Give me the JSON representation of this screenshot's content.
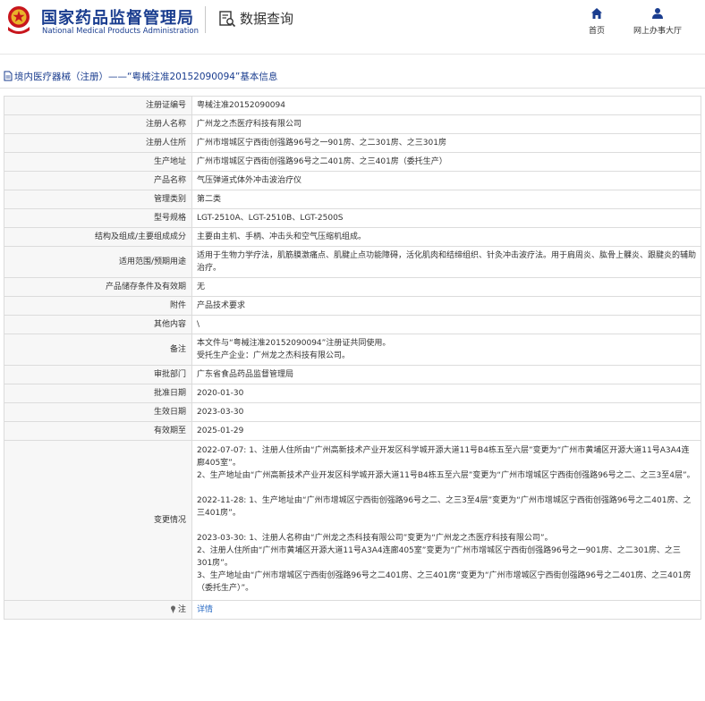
{
  "header": {
    "brand_cn": "国家药品监督管理局",
    "brand_en": "National Medical Products Administration",
    "query_label": "数据查询",
    "nav": [
      {
        "label": "首页",
        "icon": "home-icon"
      },
      {
        "label": "网上办事大厅",
        "icon": "user-icon"
      }
    ],
    "brand_color": "#1a3d8f",
    "logo_color": "#c8161d"
  },
  "breadcrumb": "境内医疗器械（注册）——“粤械注准20152090094”基本信息",
  "fields": [
    {
      "label": "注册证编号",
      "value": "粤械注准20152090094"
    },
    {
      "label": "注册人名称",
      "value": "广州龙之杰医疗科技有限公司"
    },
    {
      "label": "注册人住所",
      "value": "广州市增城区宁西街创强路96号之一901房、之二301房、之三301房"
    },
    {
      "label": "生产地址",
      "value": "广州市增城区宁西街创强路96号之二401房、之三401房（委托生产）"
    },
    {
      "label": "产品名称",
      "value": "气压弹道式体外冲击波治疗仪"
    },
    {
      "label": "管理类别",
      "value": "第二类"
    },
    {
      "label": "型号规格",
      "value": "LGT-2510A、LGT-2510B、LGT-2500S"
    },
    {
      "label": "结构及组成/主要组成成分",
      "value": "主要由主机、手柄、冲击头和空气压缩机组成。"
    },
    {
      "label": "适用范围/预期用途",
      "value": "适用于生物力学疗法，肌筋膜激痛点、肌腱止点功能障碍，活化肌肉和结缔组织、针灸冲击波疗法。用于肩周炎、肱骨上髁炎、跟腱炎的辅助治疗。"
    },
    {
      "label": "产品储存条件及有效期",
      "value": "无"
    },
    {
      "label": "附件",
      "value": "产品技术要求"
    },
    {
      "label": "其他内容",
      "value": "\\"
    },
    {
      "label": "备注",
      "lines": [
        "本文件与“粤械注准20152090094”注册证共同使用。",
        "受托生产企业：广州龙之杰科技有限公司。"
      ]
    },
    {
      "label": "审批部门",
      "value": "广东省食品药品监督管理局"
    },
    {
      "label": "批准日期",
      "value": "2020-01-30"
    },
    {
      "label": "生效日期",
      "value": "2023-03-30"
    },
    {
      "label": "有效期至",
      "value": "2025-01-29"
    }
  ],
  "changes": {
    "label": "变更情况",
    "blocks": [
      [
        "2022-07-07: 1、注册人住所由“广州高新技术产业开发区科学城开源大道11号B4栋五至六层”变更为“广州市黄埔区开源大道11号A3A4连廊405室”。",
        "2、生产地址由“广州高新技术产业开发区科学城开源大道11号B4栋五至六层”变更为“广州市增城区宁西街创强路96号之二、之三3至4层”。"
      ],
      [
        "2022-11-28: 1、生产地址由“广州市增城区宁西街创强路96号之二、之三3至4层”变更为“广州市增城区宁西街创强路96号之二401房、之三401房”。"
      ],
      [
        "2023-03-30: 1、注册人名称由“广州龙之杰科技有限公司”变更为“广州龙之杰医疗科技有限公司”。",
        "2、注册人住所由“广州市黄埔区开源大道11号A3A4连廊405室”变更为“广州市增城区宁西街创强路96号之一901房、之二301房、之三301房”。",
        "3、生产地址由“广州市增城区宁西街创强路96号之二401房、之三401房”变更为“广州市增城区宁西街创强路96号之二401房、之三401房（委托生产）”。"
      ]
    ]
  },
  "note": {
    "label": "注",
    "link": "详情",
    "link_color": "#2b6cc4"
  }
}
